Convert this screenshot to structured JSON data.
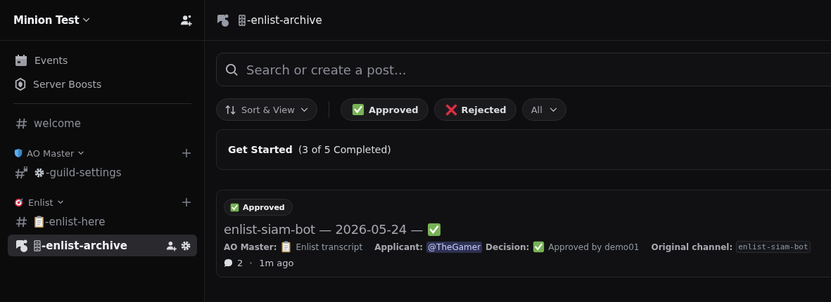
{
  "server": {
    "name": "Minion Test"
  },
  "sidebar": {
    "items": [
      {
        "kind": "events",
        "label": "Events"
      },
      {
        "kind": "boosts",
        "label": "Server Boosts"
      }
    ],
    "channels": [
      {
        "kind": "text",
        "name": "welcome",
        "selected": false
      }
    ],
    "categories": [
      {
        "name": "AO Master",
        "icon": {
          "kind": "shield"
        },
        "channels": [
          {
            "kind": "locked",
            "emoji": {
              "kind": "gear"
            },
            "name": "-guild-settings",
            "selected": false
          }
        ]
      },
      {
        "name": "Enlist",
        "icon": {
          "kind": "target"
        },
        "channels": [
          {
            "kind": "text",
            "emoji": {
              "kind": "clipboard"
            },
            "name": "-enlist-here",
            "selected": false
          },
          {
            "kind": "forum",
            "emoji": {
              "kind": "cabinet"
            },
            "name": "-enlist-archive",
            "selected": true
          }
        ]
      }
    ]
  },
  "header": {
    "emoji": {
      "kind": "cabinet"
    },
    "title": "-enlist-archive"
  },
  "search": {
    "placeholder": "Search or create a post..."
  },
  "filters": [
    {
      "kind": "sort",
      "label": "Sort & View"
    },
    {
      "kind": "tag",
      "emoji": {
        "kind": "check"
      },
      "label": "Approved"
    },
    {
      "kind": "tag",
      "emoji": {
        "kind": "cross"
      },
      "label": "Rejected"
    },
    {
      "kind": "dropdown",
      "label": "All"
    }
  ],
  "get_started": {
    "title": "Get Started",
    "progress": "(3 of 5 Completed)"
  },
  "posts": [
    {
      "tag": {
        "emoji": {
          "kind": "check"
        },
        "label": "Approved"
      },
      "title": "enlist-siam-bot — 2026-05-24 —",
      "title_emoji": {
        "kind": "check"
      },
      "preview": [
        {
          "kind": "label",
          "text": "AO Master:"
        },
        {
          "kind": "clipboard"
        },
        {
          "kind": "text",
          "text": "Enlist transcript"
        },
        {
          "kind": "label",
          "text": "Applicant:"
        },
        {
          "kind": "mention",
          "text": "@TheGamer"
        },
        {
          "kind": "label",
          "text": "Decision:"
        },
        {
          "kind": "check"
        },
        {
          "kind": "text",
          "text": "Approved by demo01"
        },
        {
          "kind": "label",
          "text": "Original channel:"
        },
        {
          "kind": "code",
          "text": "enlist-siam-bot"
        }
      ],
      "replies": "2",
      "time": "1m ago"
    }
  ]
}
